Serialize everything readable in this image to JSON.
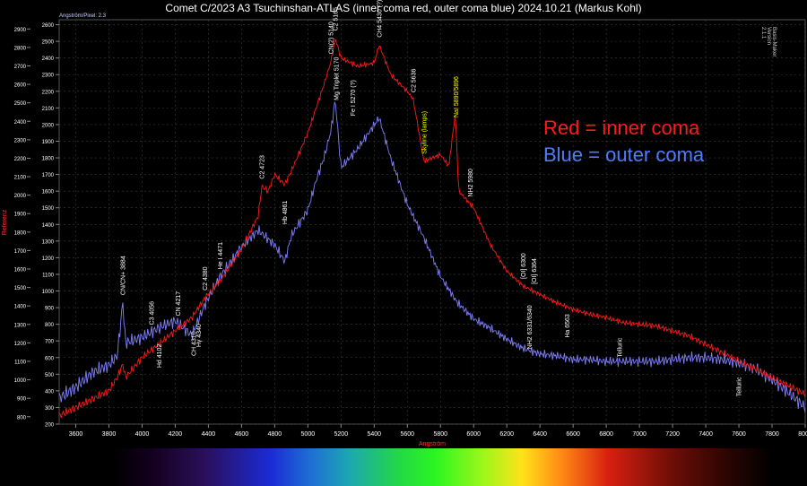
{
  "title": "Comet C/2023 A3 Tsuchinshan-ATLAS (inner coma red, outer coma blue) 2024.10.21 (Markus Kohl)",
  "top_label": "Angström/Pixel: 2.3",
  "side_label": "Basis-Maker Version 2.1.1",
  "legend": {
    "red": "Red = inner coma",
    "blue": "Blue = outer coma"
  },
  "colors": {
    "red_series": "#ff1a1a",
    "blue_series": "#7f7fff",
    "axis_text": "#ffffff",
    "axis_title": "#ff3030",
    "annotation": "#ffffff",
    "highlight_annotation": "#ffff00"
  },
  "chart_data": {
    "type": "line",
    "title": "Comet C/2023 A3 Tsuchinshan-ATLAS (inner coma red, outer coma blue) 2024.10.21 (Markus Kohl)",
    "xlabel": "Angström",
    "ylabel": "Referenz",
    "xlim": [
      3500,
      8000
    ],
    "x_ticks": [
      3600,
      3800,
      4000,
      4200,
      4400,
      4600,
      4800,
      5000,
      5200,
      5400,
      5600,
      5800,
      6000,
      6200,
      6400,
      6600,
      6800,
      7000,
      7200,
      7400,
      7600,
      7800,
      8000
    ],
    "y_ticks_left": [
      800,
      900,
      1000,
      1100,
      1200,
      1300,
      1400,
      1500,
      1600,
      1700,
      1800,
      1900,
      2000,
      2100,
      2200,
      2300,
      2400,
      2500,
      2600,
      2700,
      2800,
      2900
    ],
    "y_ticks_right": [
      200,
      300,
      400,
      500,
      600,
      700,
      800,
      900,
      1000,
      1100,
      1200,
      1300,
      1400,
      1500,
      1600,
      1700,
      1800,
      1900,
      2000,
      2100,
      2200,
      2300,
      2400,
      2500,
      2600
    ],
    "grid": true,
    "series": [
      {
        "name": "inner coma",
        "color": "red",
        "axis": "right",
        "x": [
          3500,
          3600,
          3700,
          3800,
          3850,
          3884,
          3900,
          4000,
          4100,
          4200,
          4250,
          4300,
          4380,
          4471,
          4600,
          4700,
          4723,
          4760,
          4800,
          4861,
          4900,
          5000,
          5050,
          5100,
          5140,
          5165,
          5200,
          5300,
          5400,
          5430,
          5500,
          5600,
          5636,
          5700,
          5750,
          5800,
          5850,
          5890,
          5910,
          6000,
          6100,
          6200,
          6300,
          6400,
          6500,
          6600,
          6700,
          6800,
          6900,
          7000,
          7100,
          7200,
          7300,
          7400,
          7500,
          7600,
          7700,
          7800,
          7900,
          8000
        ],
        "y": [
          250,
          300,
          350,
          400,
          480,
          560,
          480,
          600,
          680,
          760,
          800,
          840,
          960,
          1060,
          1250,
          1450,
          1630,
          1600,
          1700,
          1640,
          1720,
          1950,
          2100,
          2250,
          2380,
          2520,
          2400,
          2350,
          2370,
          2480,
          2300,
          2200,
          2150,
          1780,
          1800,
          1820,
          1750,
          2070,
          1600,
          1500,
          1280,
          1120,
          1030,
          980,
          930,
          890,
          860,
          840,
          810,
          800,
          790,
          760,
          730,
          680,
          630,
          580,
          530,
          480,
          430,
          380
        ]
      },
      {
        "name": "outer coma",
        "color": "blue",
        "axis": "left",
        "x": [
          3500,
          3600,
          3700,
          3800,
          3850,
          3884,
          3900,
          4000,
          4100,
          4200,
          4300,
          4380,
          4471,
          4600,
          4700,
          4800,
          4861,
          4900,
          5000,
          5050,
          5100,
          5140,
          5165,
          5200,
          5300,
          5400,
          5430,
          5500,
          5600,
          5700,
          5800,
          5900,
          6000,
          6100,
          6200,
          6300,
          6400,
          6500,
          6600,
          6700,
          6800,
          6900,
          7000,
          7100,
          7200,
          7300,
          7400,
          7500,
          7600,
          7700,
          7800,
          7900,
          8000
        ],
        "y": [
          900,
          960,
          1040,
          1080,
          1130,
          1420,
          1200,
          1230,
          1280,
          1320,
          1240,
          1410,
          1560,
          1720,
          1810,
          1730,
          1640,
          1780,
          1920,
          2080,
          2210,
          2350,
          2520,
          2150,
          2250,
          2380,
          2420,
          2200,
          1950,
          1770,
          1560,
          1420,
          1330,
          1280,
          1220,
          1170,
          1140,
          1130,
          1110,
          1110,
          1100,
          1100,
          1100,
          1100,
          1110,
          1120,
          1120,
          1110,
          1090,
          1060,
          1000,
          930,
          850
        ]
      }
    ],
    "annotations": [
      {
        "text": "CN/CN+ 3884",
        "x": 3884
      },
      {
        "text": "C3 4056",
        "x": 4056
      },
      {
        "text": "Hd 4102",
        "x": 4102
      },
      {
        "text": "CN 4217",
        "x": 4217
      },
      {
        "text": "CH 4310",
        "x": 4310
      },
      {
        "text": "Hγ 4340",
        "x": 4340
      },
      {
        "text": "C2 4380",
        "x": 4380
      },
      {
        "text": "He I 4471",
        "x": 4471
      },
      {
        "text": "C2 4723",
        "x": 4723
      },
      {
        "text": "Hb 4861",
        "x": 4861
      },
      {
        "text": "CN(2) 5140",
        "x": 5140
      },
      {
        "text": "C2 5165",
        "x": 5165
      },
      {
        "text": "Mg Triplet 5170",
        "x": 5170
      },
      {
        "text": "Fe I 5270 (?)",
        "x": 5270
      },
      {
        "text": "CH4 5430 (?)",
        "x": 5430
      },
      {
        "text": "C2 5636",
        "x": 5636
      },
      {
        "text": "Skyline (lamps)",
        "x": 5700,
        "highlight": true
      },
      {
        "text": "NaI 5890/5896",
        "x": 5893,
        "highlight": true
      },
      {
        "text": "NH2 5980",
        "x": 5980
      },
      {
        "text": "[OI] 6300",
        "x": 6300
      },
      {
        "text": "[OI] 6364",
        "x": 6364
      },
      {
        "text": "NH2 6331/6340",
        "x": 6336
      },
      {
        "text": "Ha 6563",
        "x": 6563
      },
      {
        "text": "Telluric",
        "x": 6880
      },
      {
        "text": "Telluric",
        "x": 7600
      }
    ]
  }
}
